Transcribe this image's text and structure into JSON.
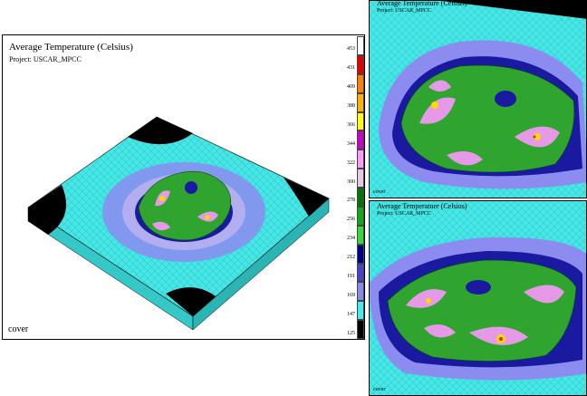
{
  "main": {
    "title": "Average Temperature (Celsius)",
    "project": "Project: USCAR_MPCC",
    "footer": "cover"
  },
  "zoom_top": {
    "title": "Average Temperature (Celsius)",
    "project": "Project: USCAR_MPCC",
    "footer": "cover"
  },
  "zoom_bottom": {
    "title": "Average Temperature (Celsius)",
    "project": "Project: USCAR_MPCC",
    "footer": "cover"
  },
  "legend": {
    "entries": [
      {
        "label": "453",
        "color": "#ffffff"
      },
      {
        "label": "431",
        "color": "#e60000"
      },
      {
        "label": "409",
        "color": "#ff7f00"
      },
      {
        "label": "388",
        "color": "#ffb000"
      },
      {
        "label": "366",
        "color": "#ffff00"
      },
      {
        "label": "344",
        "color": "#cc00cc"
      },
      {
        "label": "322",
        "color": "#ff99ff"
      },
      {
        "label": "300",
        "color": "#e6c8e6"
      },
      {
        "label": "278",
        "color": "#007700"
      },
      {
        "label": "256",
        "color": "#11aa11"
      },
      {
        "label": "234",
        "color": "#33dd33"
      },
      {
        "label": "212",
        "color": "#000088"
      },
      {
        "label": "191",
        "color": "#4444cc"
      },
      {
        "label": "169",
        "color": "#8888ee"
      },
      {
        "label": "147",
        "color": "#44eeee"
      },
      {
        "label": "125",
        "color": "#000000"
      }
    ]
  },
  "colors": {
    "mesh_background": "#44e6e6",
    "outer_ring": "#8c8cf0",
    "inner_ring": "#1a1aa0",
    "part_green": "#2fa52f",
    "hot_pink": "#e699e6",
    "hot_yellow": "#ffd800",
    "hot_red": "#cc3300",
    "cutout": "#000000"
  }
}
